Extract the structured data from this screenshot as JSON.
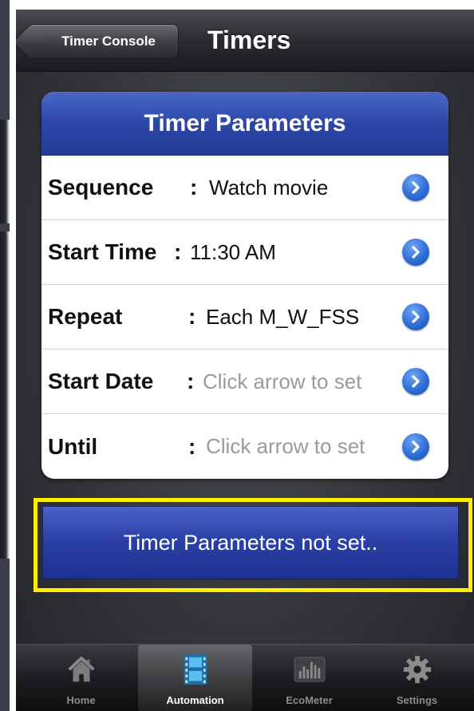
{
  "nav": {
    "back_label": "Timer Console",
    "title": "Timers"
  },
  "card": {
    "header": "Timer Parameters",
    "rows": [
      {
        "label": "Sequence",
        "separator": ":",
        "value": "Watch movie",
        "placeholder": false
      },
      {
        "label": "Start Time",
        "separator": ":",
        "value": "11:30 AM",
        "placeholder": false
      },
      {
        "label": "Repeat",
        "separator": ":",
        "value": "Each M_W_FSS",
        "placeholder": false
      },
      {
        "label": "Start Date",
        "separator": ":",
        "value": "Click arrow to set",
        "placeholder": true
      },
      {
        "label": "Until",
        "separator": ":",
        "value": "Click arrow to set",
        "placeholder": true
      }
    ]
  },
  "status": {
    "message": "Timer Parameters not set.."
  },
  "tabs": [
    {
      "label": "Home",
      "icon": "home-icon",
      "active": false
    },
    {
      "label": "Automation",
      "icon": "film-icon",
      "active": true
    },
    {
      "label": "EcoMeter",
      "icon": "bar-meter-icon",
      "active": false
    },
    {
      "label": "Settings",
      "icon": "gear-icon",
      "active": false
    }
  ],
  "colors": {
    "accent_blue": "#2d47a8",
    "highlight_yellow": "#ffee00",
    "chevron_blue": "#2e6ed6",
    "placeholder_gray": "#9a9a9a"
  }
}
